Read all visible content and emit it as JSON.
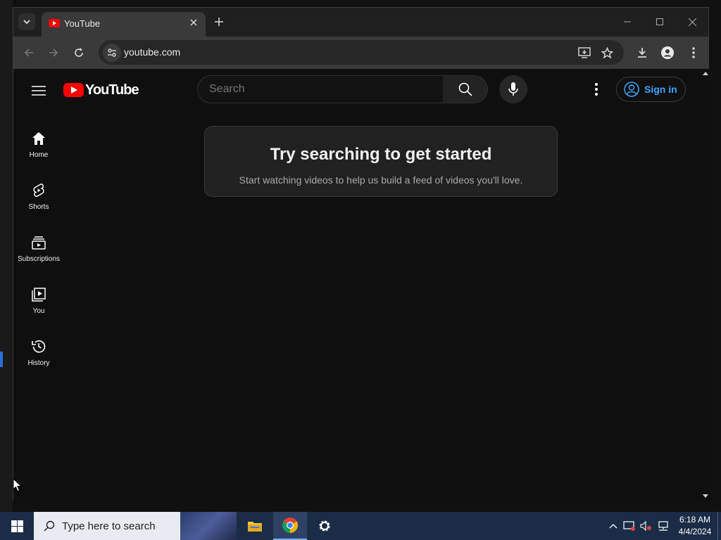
{
  "browser": {
    "tab_title": "YouTube",
    "url": "youtube.com"
  },
  "youtube": {
    "logo_text": "YouTube",
    "search_placeholder": "Search",
    "sign_in_label": "Sign in",
    "guide": [
      {
        "label": "Home",
        "icon": "home-icon"
      },
      {
        "label": "Shorts",
        "icon": "shorts-icon"
      },
      {
        "label": "Subscriptions",
        "icon": "subscriptions-icon"
      },
      {
        "label": "You",
        "icon": "you-icon"
      },
      {
        "label": "History",
        "icon": "history-icon"
      }
    ],
    "prompt": {
      "title": "Try searching to get started",
      "subtitle": "Start watching videos to help us build a feed of videos you'll love."
    },
    "colors": {
      "brand_red": "#ff0000",
      "link_blue": "#3ea6ff",
      "background": "#0f0f0f"
    }
  },
  "taskbar": {
    "search_placeholder": "Type here to search",
    "time": "6:18 AM",
    "date": "4/4/2024"
  }
}
